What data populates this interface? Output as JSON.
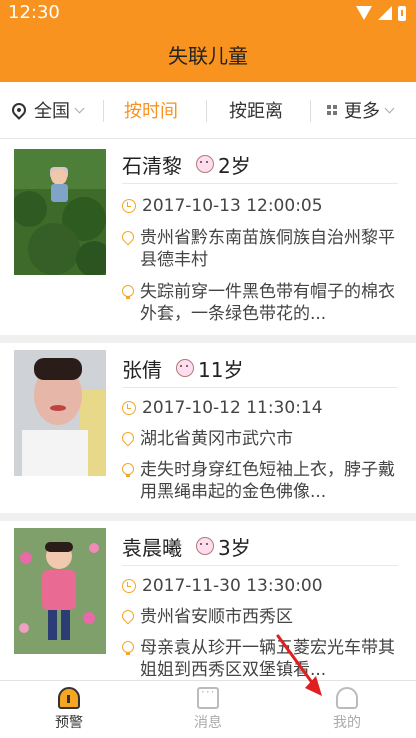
{
  "status": {
    "time": "12:30"
  },
  "header": {
    "title": "失联儿童"
  },
  "filters": {
    "region": "全国",
    "by_time": "按时间",
    "by_distance": "按距离",
    "more": "更多"
  },
  "children": [
    {
      "name": "石清黎",
      "age": "2岁",
      "time": "2017-10-13 12:00:05",
      "location": "贵州省黔东南苗族侗族自治州黎平县德丰村",
      "description": "失踪前穿一件黑色带有帽子的棉衣外套，一条绿色带花的..."
    },
    {
      "name": "张倩",
      "age": "11岁",
      "time": "2017-10-12 11:30:14",
      "location": "湖北省黄冈市武穴市",
      "description": "走失时身穿红色短袖上衣，脖子戴用黑绳串起的金色佛像..."
    },
    {
      "name": "袁晨曦",
      "age": "3岁",
      "time": "2017-11-30 13:30:00",
      "location": "贵州省安顺市西秀区",
      "description": "母亲袁从珍开一辆五菱宏光车带其姐姐到西秀区双堡镇看..."
    }
  ],
  "tabs": {
    "alert": "预警",
    "messages": "消息",
    "me": "我的"
  },
  "colors": {
    "accent": "#f7931e",
    "icon": "#f5a623"
  }
}
